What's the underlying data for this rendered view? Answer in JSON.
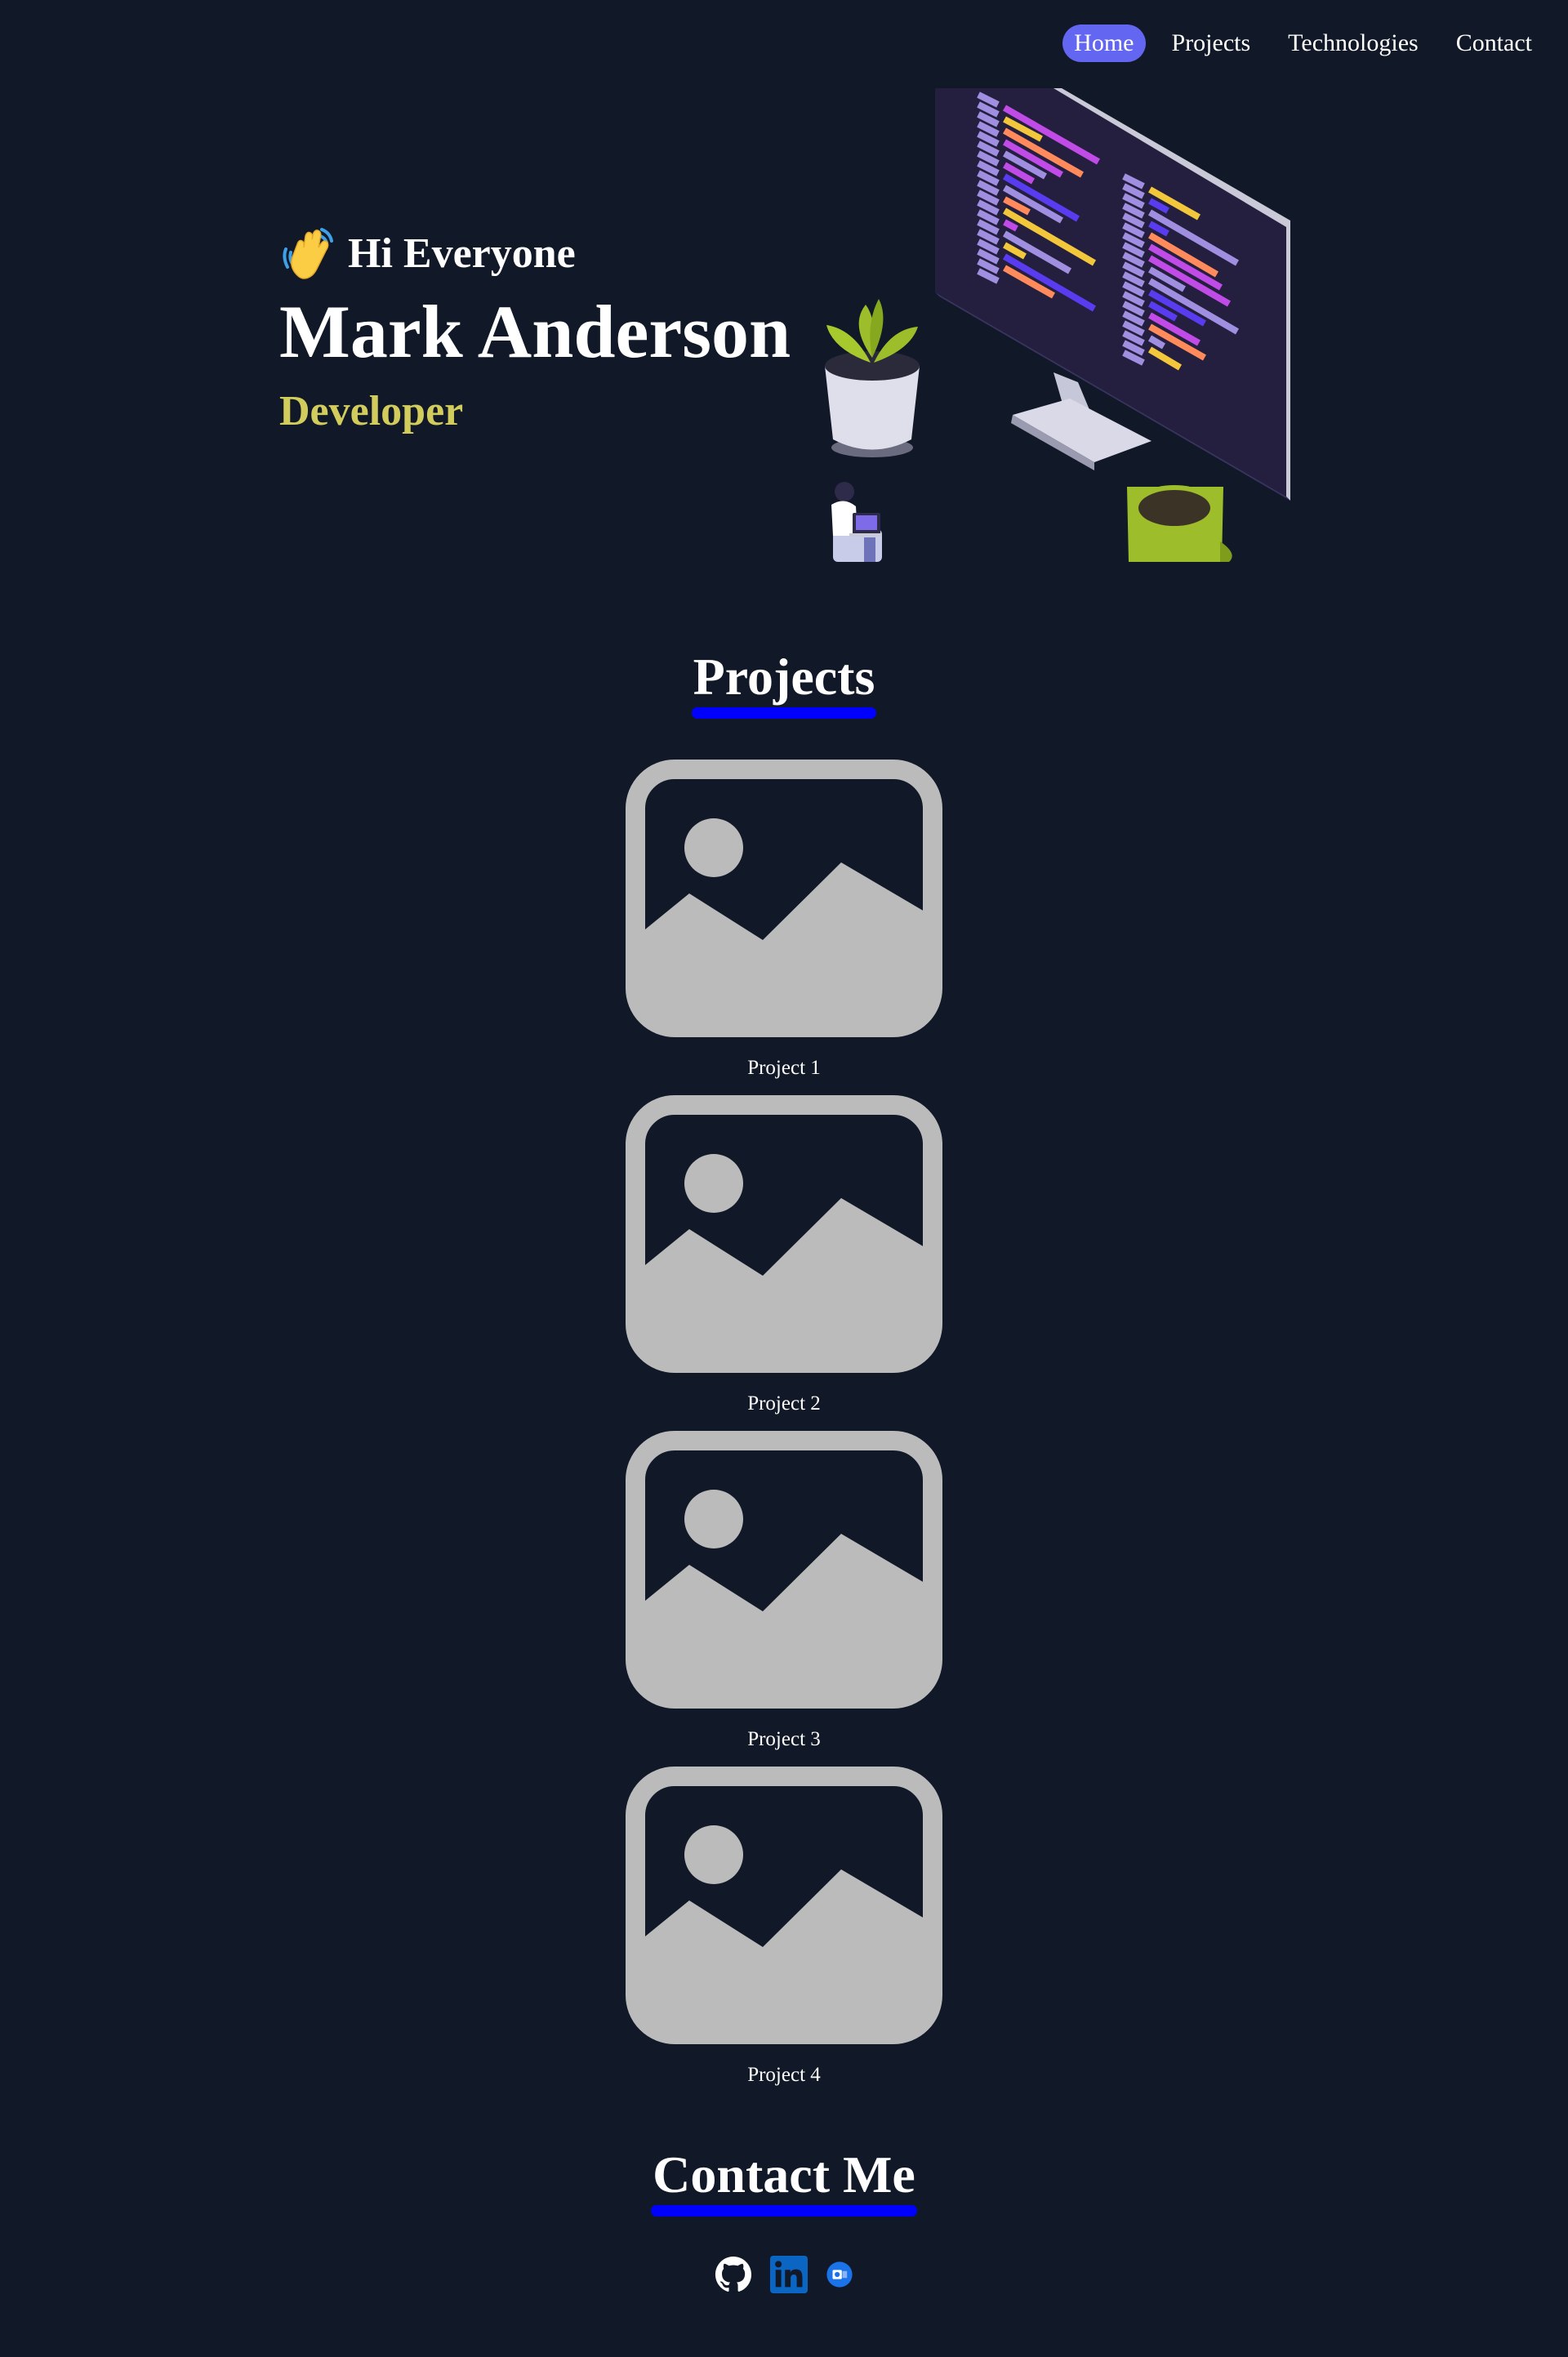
{
  "nav": {
    "items": [
      {
        "label": "Home",
        "active": true
      },
      {
        "label": "Projects",
        "active": false
      },
      {
        "label": "Technologies",
        "active": false
      },
      {
        "label": "Contact",
        "active": false
      }
    ]
  },
  "hero": {
    "greeting": "Hi Everyone",
    "greeting_icon": "waving-hand-icon",
    "name": "Mark Anderson",
    "role": "Developer",
    "illustration": "developer-workspace-illustration"
  },
  "projects": {
    "title": "Projects",
    "items": [
      {
        "label": "Project 1",
        "icon": "image-placeholder-icon"
      },
      {
        "label": "Project 2",
        "icon": "image-placeholder-icon"
      },
      {
        "label": "Project 3",
        "icon": "image-placeholder-icon"
      },
      {
        "label": "Project 4",
        "icon": "image-placeholder-icon"
      }
    ]
  },
  "contact": {
    "title": "Contact Me",
    "links": [
      {
        "icon": "github-icon"
      },
      {
        "icon": "linkedin-icon"
      },
      {
        "icon": "outlook-icon"
      }
    ]
  },
  "colors": {
    "background": "#111827",
    "nav_active": "#6366f1",
    "role": "#d2cc5c",
    "underline": "#0000ff",
    "placeholder": "#bbbbbb"
  }
}
